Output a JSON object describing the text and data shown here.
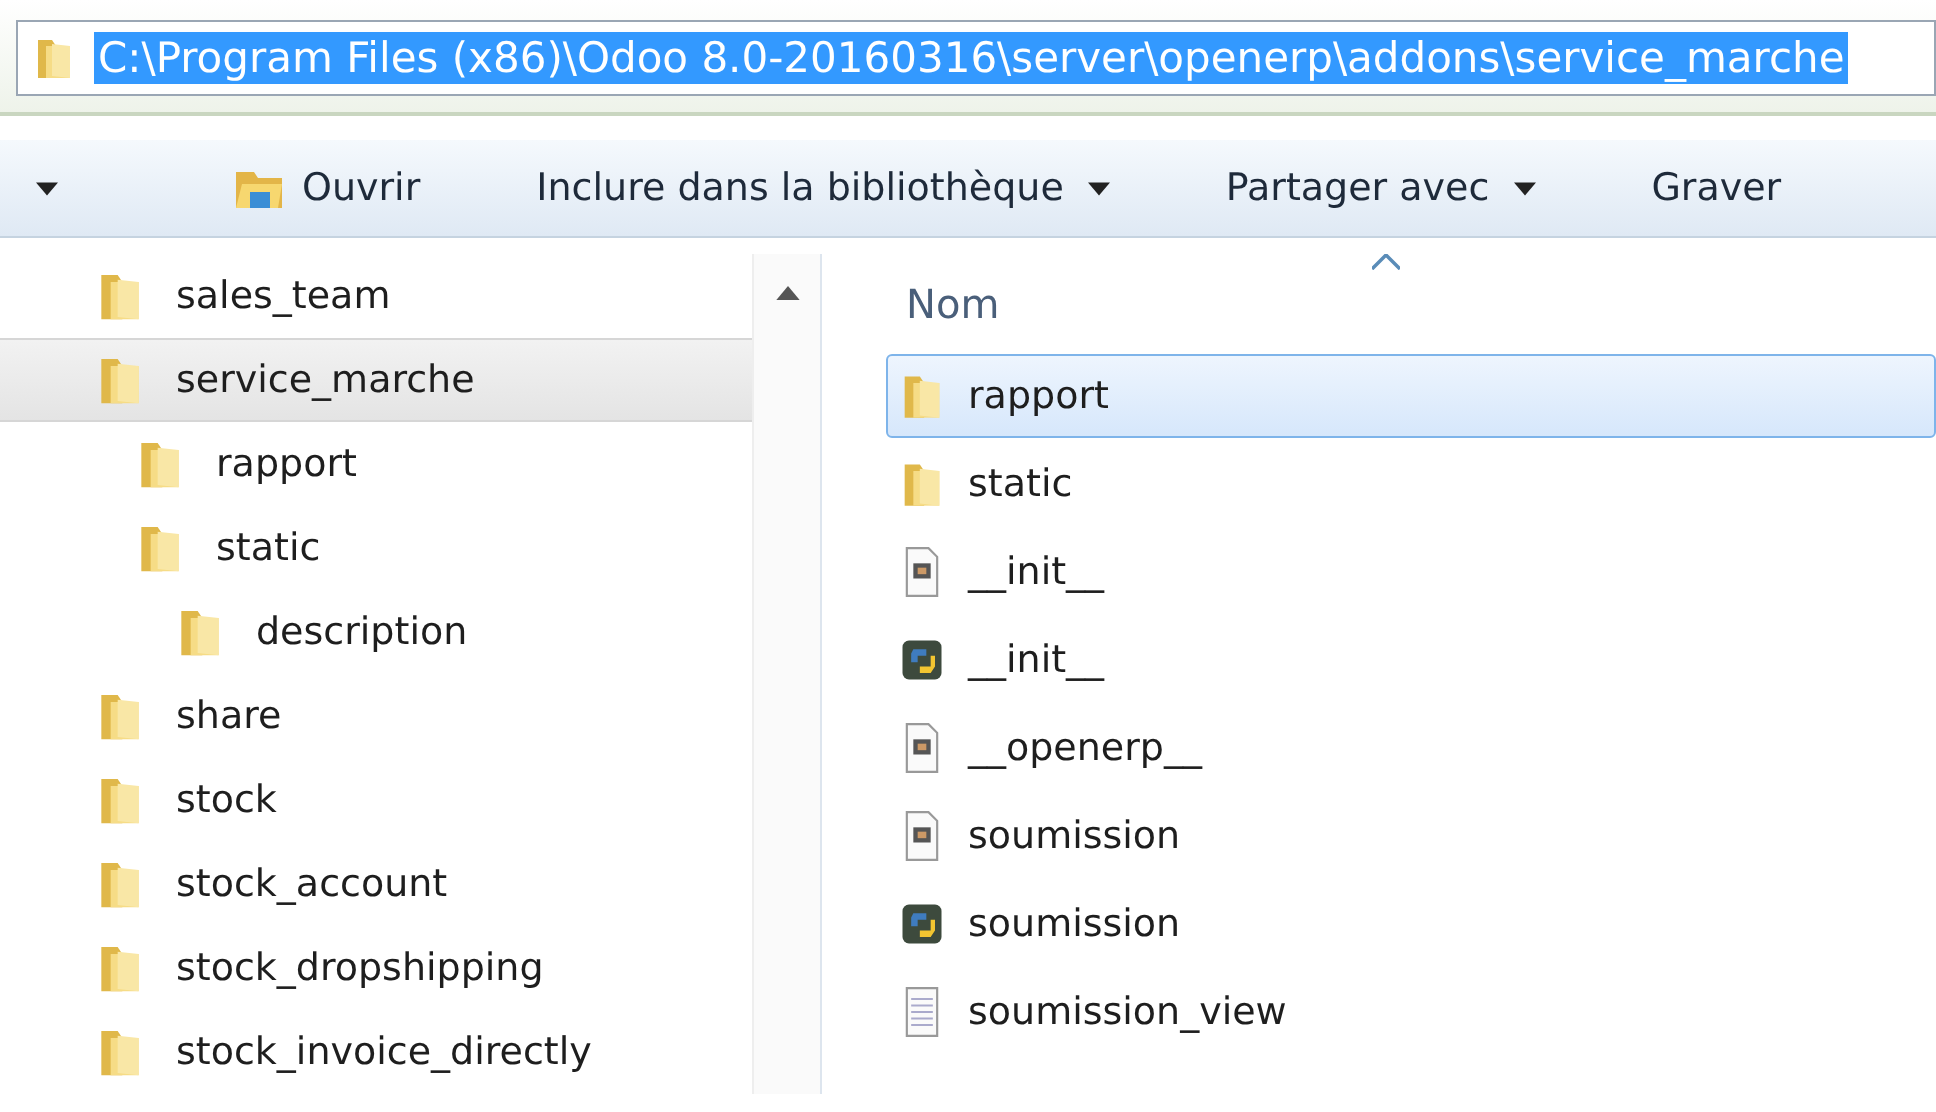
{
  "address_bar": {
    "path": "C:\\Program Files (x86)\\Odoo 8.0-20160316\\server\\openerp\\addons\\service_marche",
    "text_selected": true
  },
  "toolbar": {
    "items": [
      {
        "label": "Ouvrir",
        "kind": "open",
        "has_menu": false
      },
      {
        "label": "Inclure dans la bibliothèque",
        "kind": "plain",
        "has_menu": true
      },
      {
        "label": "Partager avec",
        "kind": "plain",
        "has_menu": true
      },
      {
        "label": "Graver",
        "kind": "plain",
        "has_menu": false
      }
    ]
  },
  "navigation_tree": {
    "items": [
      {
        "label": "sales_team",
        "selected": false
      },
      {
        "label": "service_marche",
        "selected": true,
        "children": [
          {
            "label": "rapport",
            "selected": false
          },
          {
            "label": "static",
            "selected": false,
            "children": [
              {
                "label": "description",
                "selected": false
              }
            ]
          }
        ]
      },
      {
        "label": "share",
        "selected": false
      },
      {
        "label": "stock",
        "selected": false
      },
      {
        "label": "stock_account",
        "selected": false
      },
      {
        "label": "stock_dropshipping",
        "selected": false
      },
      {
        "label": "stock_invoice_directly",
        "selected": false
      }
    ]
  },
  "file_list": {
    "columns": [
      "Nom"
    ],
    "rows": [
      {
        "name": "rapport",
        "kind": "folder",
        "selected": true
      },
      {
        "name": "static",
        "kind": "folder",
        "selected": false
      },
      {
        "name": "__init__",
        "kind": "compiled",
        "selected": false
      },
      {
        "name": "__init__",
        "kind": "python",
        "selected": false
      },
      {
        "name": "__openerp__",
        "kind": "compiled",
        "selected": false
      },
      {
        "name": "soumission",
        "kind": "compiled",
        "selected": false
      },
      {
        "name": "soumission",
        "kind": "python",
        "selected": false
      },
      {
        "name": "soumission_view",
        "kind": "text",
        "selected": false
      }
    ]
  }
}
